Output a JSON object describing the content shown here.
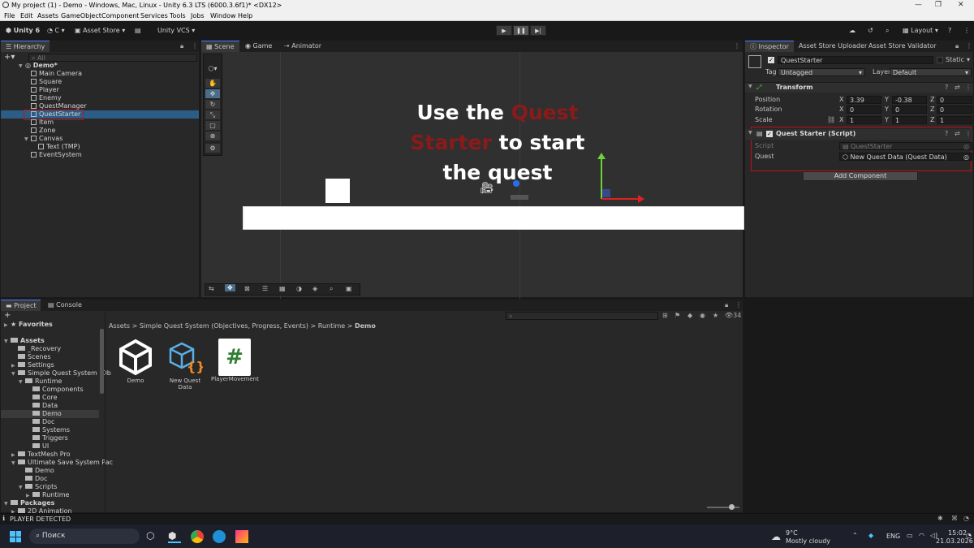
{
  "window": {
    "title": "My project (1) - Demo - Windows, Mac, Linux - Unity 6.3 LTS (6000.3.6f1)* <DX12>"
  },
  "menu": [
    "File",
    "Edit",
    "Assets",
    "GameObject",
    "Component",
    "Services",
    "Tools",
    "Jobs",
    "Window",
    "Help"
  ],
  "toolbar": {
    "account": "Unity 6",
    "cloud": "C",
    "asset_store": "Asset Store",
    "vcs": "Unity VCS",
    "layout": "Layout"
  },
  "hierarchy": {
    "tab": "Hierarchy",
    "search_placeholder": "All",
    "scene": "Demo*",
    "items": [
      {
        "label": "Main Camera"
      },
      {
        "label": "Square"
      },
      {
        "label": "Player"
      },
      {
        "label": "Enemy"
      },
      {
        "label": "QuestManager"
      },
      {
        "label": "QuestStarter"
      },
      {
        "label": "Item"
      },
      {
        "label": "Zone"
      },
      {
        "label": "Canvas"
      },
      {
        "label": "Text (TMP)"
      },
      {
        "label": "EventSystem"
      }
    ]
  },
  "scene_tabs": [
    "Scene",
    "Game",
    "Animator"
  ],
  "scene_text": {
    "l1a": "Use the ",
    "l1b": "Quest",
    "l2a": "Starter",
    "l2b": " to start",
    "l3": "the quest"
  },
  "colors": {
    "accent": "#4c7dff",
    "quest_red": "#8b1a1a",
    "highlight_red": "#c0101a"
  },
  "inspector": {
    "tabs": [
      "Inspector",
      "Asset Store Uploader",
      "Asset Store Validator"
    ],
    "object_name": "QuestStarter",
    "static_label": "Static",
    "tag_label": "Tag",
    "tag_value": "Untagged",
    "layer_label": "Layer",
    "layer_value": "Default",
    "transform": {
      "title": "Transform",
      "position": {
        "label": "Position",
        "x": "3.39",
        "y": "-0.38",
        "z": "0"
      },
      "rotation": {
        "label": "Rotation",
        "x": "0",
        "y": "0",
        "z": "0"
      },
      "scale": {
        "label": "Scale",
        "x": "1",
        "y": "1",
        "z": "1"
      }
    },
    "script_component": {
      "title": "Quest Starter (Script)",
      "script_label": "Script",
      "script_value": "QuestStarter",
      "quest_label": "Quest",
      "quest_value": "New Quest Data (Quest Data)"
    },
    "add_component": "Add Component"
  },
  "bottom_tabs": [
    "Project",
    "Console"
  ],
  "project": {
    "favorites": "Favorites",
    "count": "34",
    "breadcrumb": [
      "Assets",
      "Simple Quest System (Objectives, Progress, Events)",
      "Runtime",
      "Demo"
    ],
    "tree": [
      {
        "label": "Assets",
        "indent": 0
      },
      {
        "label": "_Recovery",
        "indent": 1
      },
      {
        "label": "Scenes",
        "indent": 1
      },
      {
        "label": "Settings",
        "indent": 1
      },
      {
        "label": "Simple Quest System (Ob",
        "indent": 1
      },
      {
        "label": "Runtime",
        "indent": 2
      },
      {
        "label": "Components",
        "indent": 3
      },
      {
        "label": "Core",
        "indent": 3
      },
      {
        "label": "Data",
        "indent": 3
      },
      {
        "label": "Demo",
        "indent": 3
      },
      {
        "label": "Doc",
        "indent": 3
      },
      {
        "label": "Systems",
        "indent": 3
      },
      {
        "label": "Triggers",
        "indent": 3
      },
      {
        "label": "UI",
        "indent": 3
      },
      {
        "label": "TextMesh Pro",
        "indent": 1
      },
      {
        "label": "Ultimate Save System Pac",
        "indent": 1
      },
      {
        "label": "Demo",
        "indent": 2
      },
      {
        "label": "Doc",
        "indent": 2
      },
      {
        "label": "Scripts",
        "indent": 2
      },
      {
        "label": "Runtime",
        "indent": 3
      },
      {
        "label": "Packages",
        "indent": 0
      },
      {
        "label": "2D Animation",
        "indent": 1
      }
    ],
    "assets": [
      {
        "label": "Demo"
      },
      {
        "label": "New Quest Data"
      },
      {
        "label": "PlayerMovement"
      }
    ]
  },
  "status": {
    "message": "PLAYER DETECTED"
  },
  "taskbar": {
    "search": "Поиск",
    "temp": "9°C",
    "weather": "Mostly cloudy",
    "lang": "ENG",
    "time": "15:02",
    "date": "21.03.2026"
  }
}
